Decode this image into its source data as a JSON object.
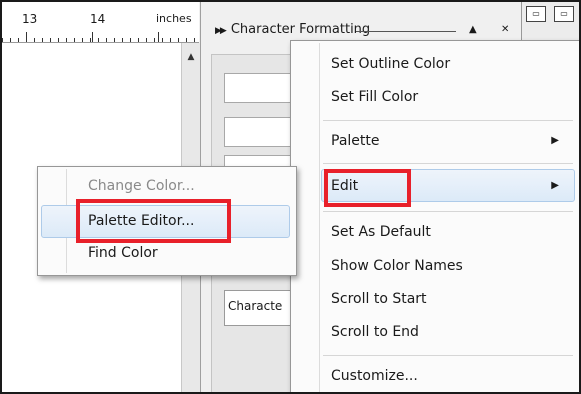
{
  "ruler": {
    "labels": [
      "13",
      "14"
    ],
    "unit": "inches"
  },
  "panel": {
    "title": "Character Formatting",
    "combo_text": "Characte"
  },
  "context_menu": {
    "items": [
      {
        "label": "Set Outline Color"
      },
      {
        "label": "Set Fill Color"
      },
      {
        "label": "Palette",
        "submenu": true
      },
      {
        "label": "Edit",
        "submenu": true,
        "highlighted": true
      },
      {
        "label": "Set As Default"
      },
      {
        "label": "Show Color Names"
      },
      {
        "label": "Scroll to Start"
      },
      {
        "label": "Scroll to End"
      },
      {
        "label": "Customize..."
      }
    ]
  },
  "edit_submenu": {
    "items": [
      {
        "label": "Change Color...",
        "disabled": true
      },
      {
        "label": "Palette Editor...",
        "highlighted": true
      },
      {
        "label": "Find Color"
      }
    ]
  },
  "colors": {
    "highlight_box": "#e8202a",
    "hover_bg": "#dceaf8",
    "accent_strip": "#f3e25e"
  },
  "icons": [
    "scroll-up-arrow-icon",
    "submenu-arrow-icon",
    "panel-collapse-icon"
  ]
}
